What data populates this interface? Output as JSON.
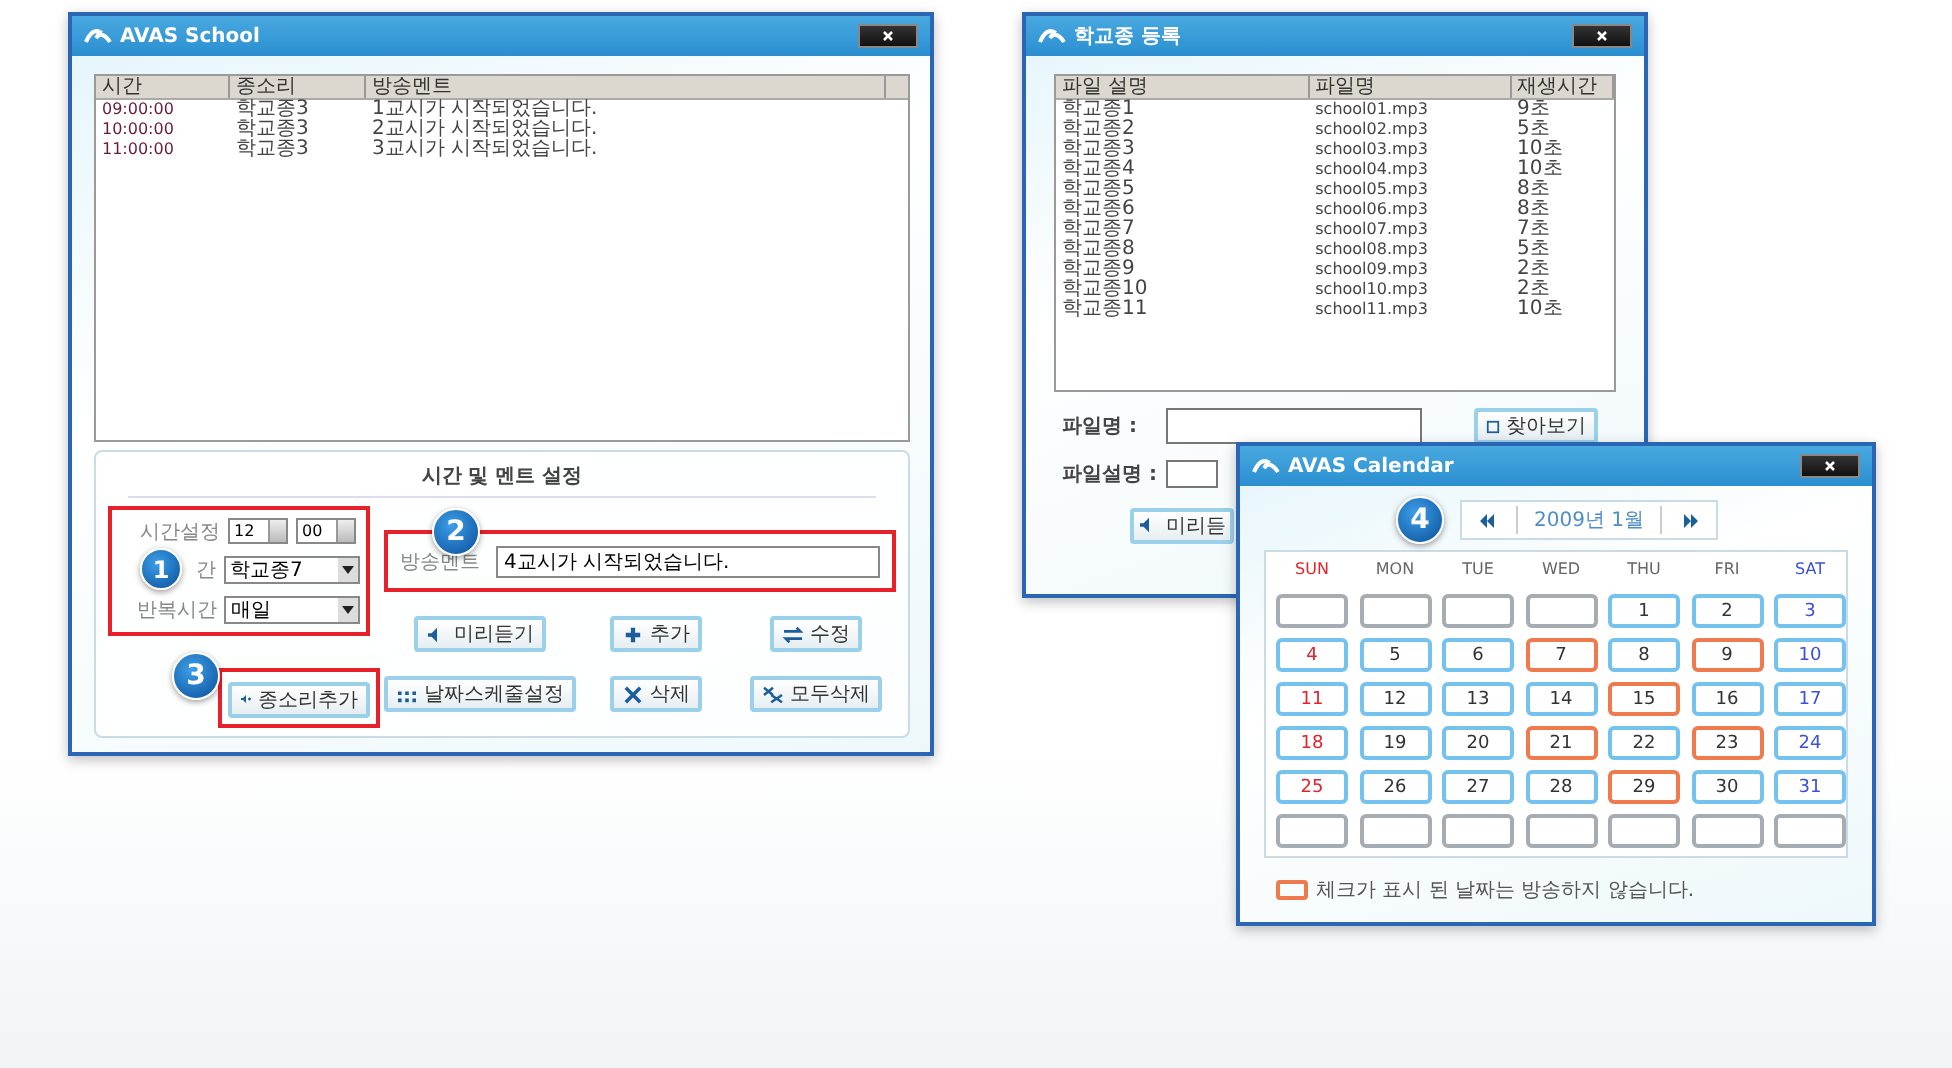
{
  "school_window": {
    "title": "AVAS School",
    "table": {
      "columns": [
        "시간",
        "종소리",
        "방송멘트"
      ],
      "rows": [
        [
          "09:00:00",
          "학교종3",
          "1교시가 시작되었습니다."
        ],
        [
          "10:00:00",
          "학교종3",
          "2교시가 시작되었습니다."
        ],
        [
          "11:00:00",
          "학교종3",
          "3교시가 시작되었습니다."
        ]
      ]
    },
    "settings": {
      "title": "시간 및 멘트 설정",
      "time_label": "시간설정",
      "hour": "12",
      "minute": "00",
      "bell_label": "간",
      "bell_value": "학교종7",
      "repeat_label": "반복시간",
      "repeat_value": "매일",
      "comment_label": "방송멘트",
      "comment_value": "4교시가 시작되었습니다."
    },
    "buttons": [
      "미리듣기",
      "추가",
      "수정",
      "날짜스케줄설정",
      "삭제",
      "모두삭제"
    ],
    "add_bell_button": "종소리추가",
    "callouts": [
      "1",
      "2",
      "3"
    ]
  },
  "bell_window": {
    "title": "학교종 등록",
    "table": {
      "columns": [
        "파일 설명",
        "파일명",
        "재생시간"
      ],
      "rows": [
        [
          "학교종1",
          "school01.mp3",
          "9초"
        ],
        [
          "학교종2",
          "school02.mp3",
          "5초"
        ],
        [
          "학교종3",
          "school03.mp3",
          "10초"
        ],
        [
          "학교종4",
          "school04.mp3",
          "10초"
        ],
        [
          "학교종5",
          "school05.mp3",
          "8초"
        ],
        [
          "학교종6",
          "school06.mp3",
          "8초"
        ],
        [
          "학교종7",
          "school07.mp3",
          "7초"
        ],
        [
          "학교종8",
          "school08.mp3",
          "5초"
        ],
        [
          "학교종9",
          "school09.mp3",
          "2초"
        ],
        [
          "학교종10",
          "school10.mp3",
          "2초"
        ],
        [
          "학교종11",
          "school11.mp3",
          "10초"
        ]
      ]
    },
    "file_name_label": "파일명 :",
    "file_desc_label": "파일설명 :",
    "browse_button": "찾아보기",
    "preview_button": "미리듣"
  },
  "calendar_window": {
    "title": "AVAS Calendar",
    "callout": "4",
    "month": "2009년 1월",
    "weekdays": [
      "SUN",
      "MON",
      "TUE",
      "WED",
      "THU",
      "FRI",
      "SAT"
    ],
    "cells": [
      {
        "kind": "empty"
      },
      {
        "kind": "empty"
      },
      {
        "kind": "empty"
      },
      {
        "kind": "empty"
      },
      {
        "kind": "day",
        "day": "1",
        "marked": false
      },
      {
        "kind": "day",
        "day": "2",
        "marked": false
      },
      {
        "kind": "day",
        "day": "3",
        "marked": false
      },
      {
        "kind": "day",
        "day": "4",
        "marked": false
      },
      {
        "kind": "day",
        "day": "5",
        "marked": false
      },
      {
        "kind": "day",
        "day": "6",
        "marked": false
      },
      {
        "kind": "day",
        "day": "7",
        "marked": true
      },
      {
        "kind": "day",
        "day": "8",
        "marked": false
      },
      {
        "kind": "day",
        "day": "9",
        "marked": true
      },
      {
        "kind": "day",
        "day": "10",
        "marked": false
      },
      {
        "kind": "day",
        "day": "11",
        "marked": false
      },
      {
        "kind": "day",
        "day": "12",
        "marked": false
      },
      {
        "kind": "day",
        "day": "13",
        "marked": false
      },
      {
        "kind": "day",
        "day": "14",
        "marked": false
      },
      {
        "kind": "day",
        "day": "15",
        "marked": true
      },
      {
        "kind": "day",
        "day": "16",
        "marked": false
      },
      {
        "kind": "day",
        "day": "17",
        "marked": false
      },
      {
        "kind": "day",
        "day": "18",
        "marked": false
      },
      {
        "kind": "day",
        "day": "19",
        "marked": false
      },
      {
        "kind": "day",
        "day": "20",
        "marked": false
      },
      {
        "kind": "day",
        "day": "21",
        "marked": true
      },
      {
        "kind": "day",
        "day": "22",
        "marked": false
      },
      {
        "kind": "day",
        "day": "23",
        "marked": true
      },
      {
        "kind": "day",
        "day": "24",
        "marked": false
      },
      {
        "kind": "day",
        "day": "25",
        "marked": false
      },
      {
        "kind": "day",
        "day": "26",
        "marked": false
      },
      {
        "kind": "day",
        "day": "27",
        "marked": false
      },
      {
        "kind": "day",
        "day": "28",
        "marked": false
      },
      {
        "kind": "day",
        "day": "29",
        "marked": true
      },
      {
        "kind": "day",
        "day": "30",
        "marked": false
      },
      {
        "kind": "day",
        "day": "31",
        "marked": false
      },
      {
        "kind": "empty"
      },
      {
        "kind": "empty"
      },
      {
        "kind": "empty"
      },
      {
        "kind": "empty"
      },
      {
        "kind": "empty"
      },
      {
        "kind": "empty"
      },
      {
        "kind": "empty"
      }
    ],
    "legend": "체크가 표시 된 날짜는 방송하지 않습니다."
  }
}
